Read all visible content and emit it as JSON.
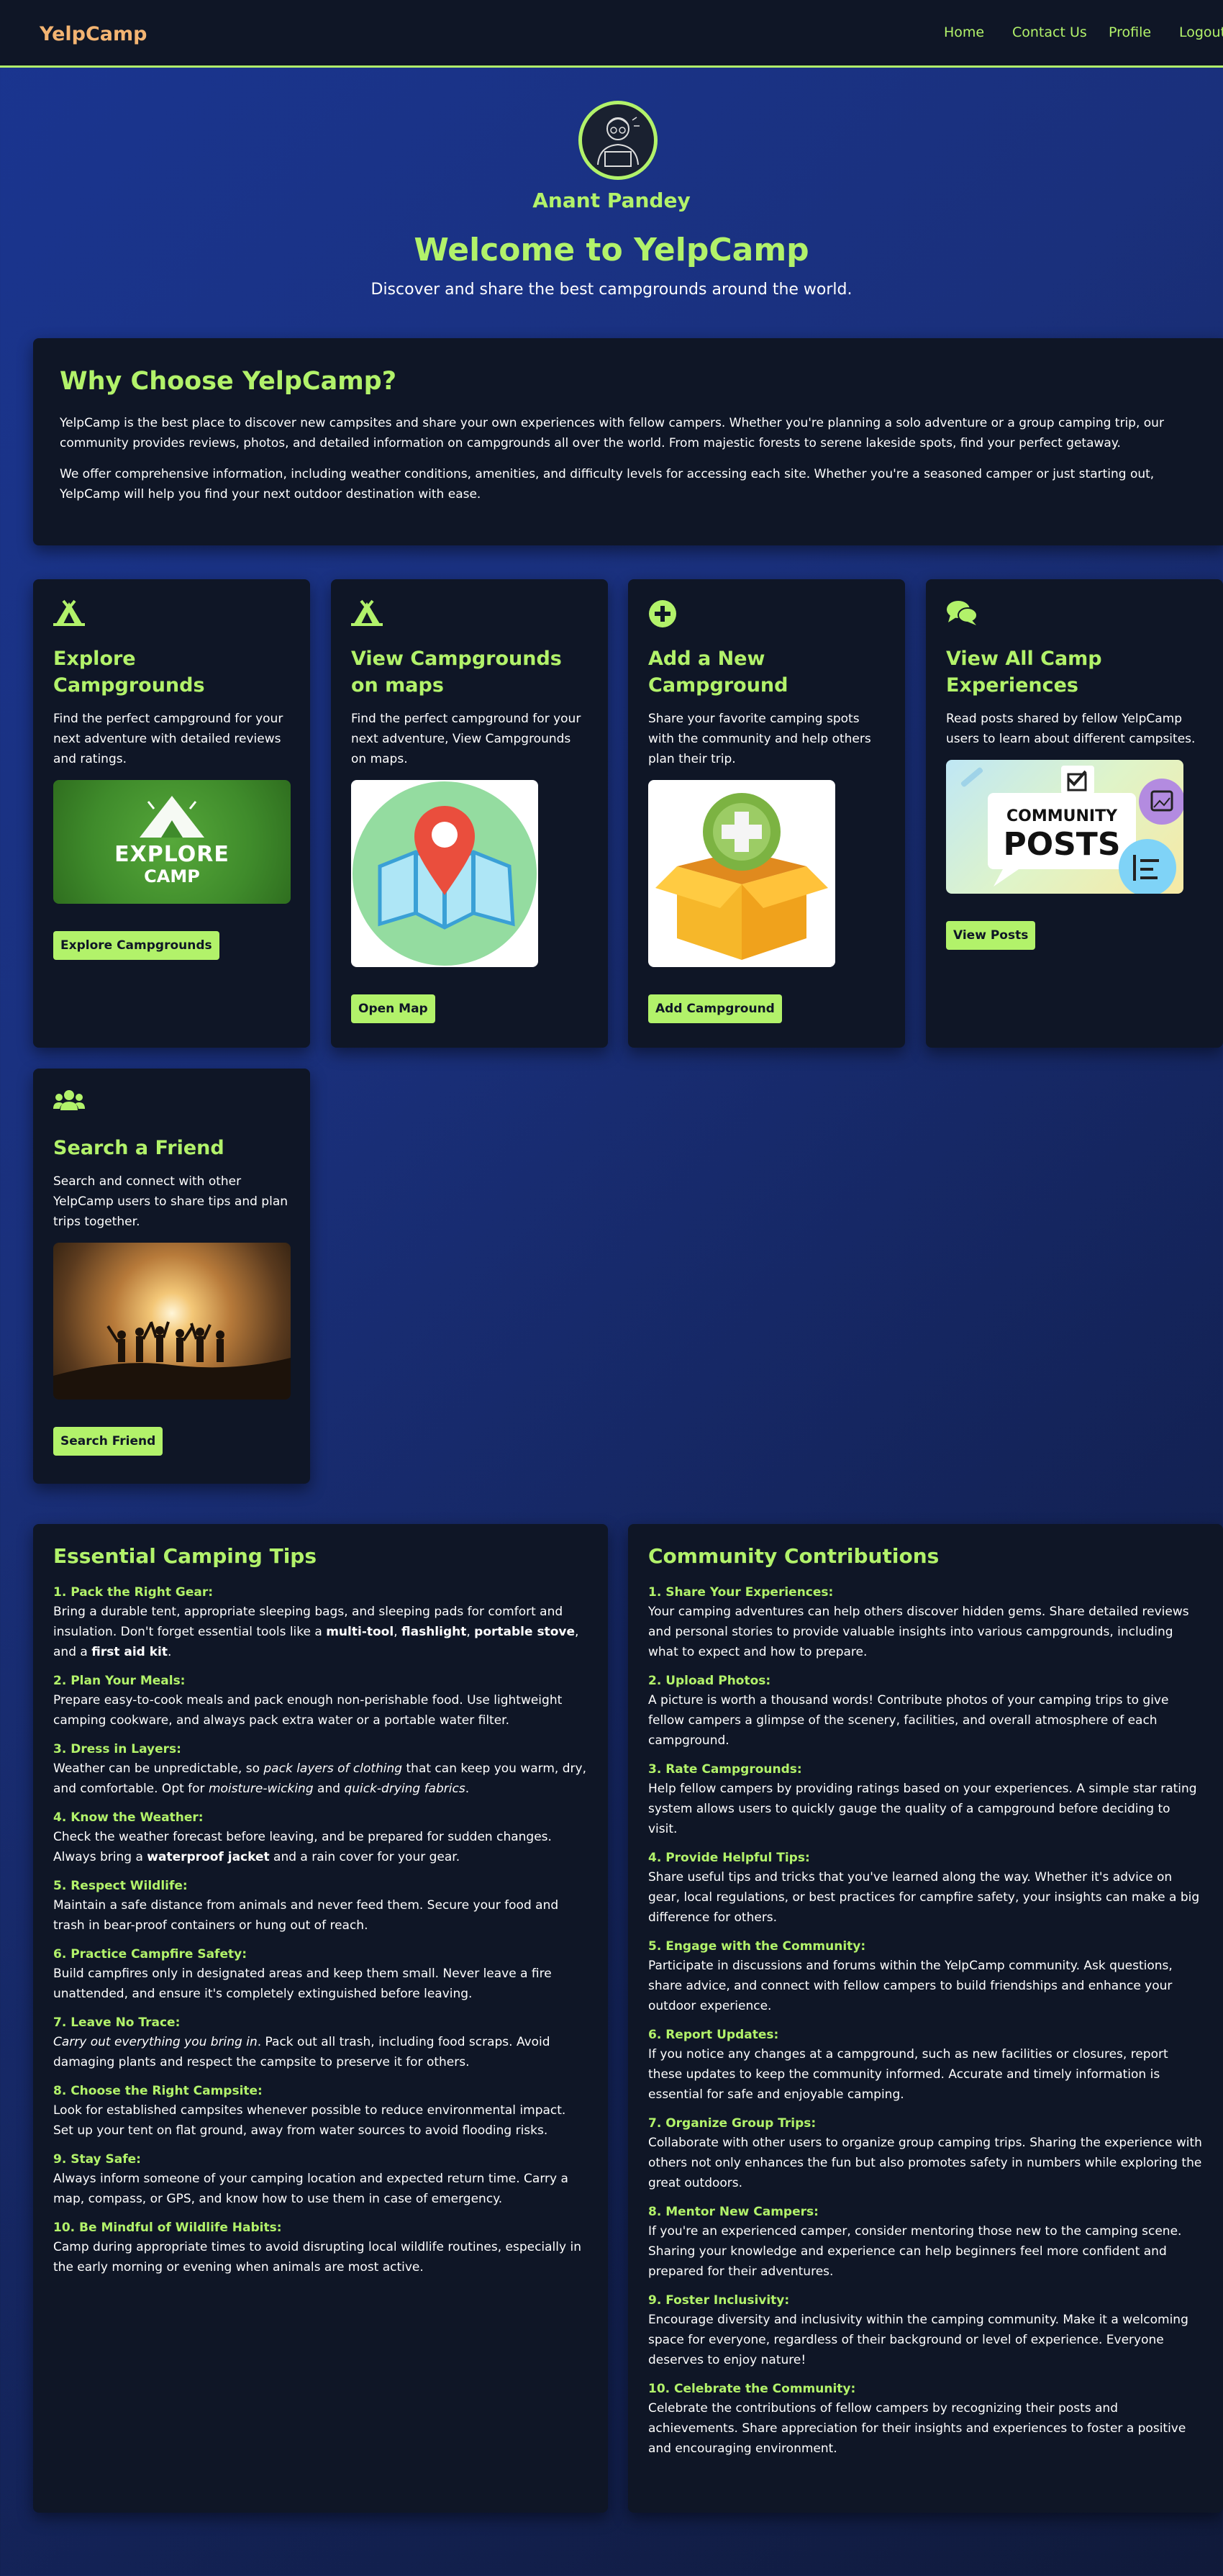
{
  "nav": {
    "brand": "YelpCamp",
    "links": [
      "Home",
      "Contact Us",
      "Profile",
      "Logout"
    ]
  },
  "hero": {
    "name": "Anant Pandey",
    "title": "Welcome to YelpCamp",
    "subtitle": "Discover and share the best campgrounds around the world."
  },
  "why": {
    "title": "Why Choose YelpCamp?",
    "paragraphs": [
      "YelpCamp is the best place to discover new campsites and share your own experiences with fellow campers. Whether you're planning a solo adventure or a group camping trip, our community provides reviews, photos, and detailed information on campgrounds all over the world. From majestic forests to serene lakeside spots, find your perfect getaway.",
      "We offer comprehensive information, including weather conditions, amenities, and difficulty levels for accessing each site. Whether you're a seasoned camper or just starting out, YelpCamp will help you find your next outdoor destination with ease."
    ]
  },
  "cards": [
    {
      "icon": "campground-icon",
      "title": "Explore Campgrounds",
      "text": "Find the perfect campground for your next adventure with detailed reviews and ratings.",
      "image_text": [
        "EXPLORE",
        "CAMP"
      ],
      "button": "Explore Campgrounds"
    },
    {
      "icon": "campground-icon",
      "title": "View Campgrounds on maps",
      "text": "Find the perfect campground for your next adventure, View Campgrounds on maps.",
      "button": "Open Map"
    },
    {
      "icon": "plus-circle-icon",
      "title": "Add a New Campground",
      "text": "Share your favorite camping spots with the community and help others plan their trip.",
      "button": "Add Campground"
    },
    {
      "icon": "comments-icon",
      "title": "View All Camp Experiences",
      "text": "Read posts shared by fellow YelpCamp users to learn about different campsites.",
      "image_text": [
        "COMMUNITY",
        "POSTS"
      ],
      "button": "View Posts"
    },
    {
      "icon": "users-icon",
      "title": "Search a Friend",
      "text": "Search and connect with other YelpCamp users to share tips and plan trips together.",
      "button": "Search Friend"
    }
  ],
  "tips": {
    "title": "Essential Camping Tips",
    "items": [
      {
        "title": "1. Pack the Right Gear:",
        "segments": [
          [
            "n",
            "Bring a durable tent, appropriate sleeping bags, and sleeping pads for comfort and insulation. Don't forget essential tools like a "
          ],
          [
            "b",
            "multi-tool"
          ],
          [
            "n",
            ", "
          ],
          [
            "b",
            "flashlight"
          ],
          [
            "n",
            ", "
          ],
          [
            "b",
            "portable stove"
          ],
          [
            "n",
            ", and a "
          ],
          [
            "b",
            "first aid kit"
          ],
          [
            "n",
            "."
          ]
        ]
      },
      {
        "title": "2. Plan Your Meals:",
        "segments": [
          [
            "n",
            "Prepare easy-to-cook meals and pack enough non-perishable food. Use lightweight camping cookware, and always pack extra water or a portable water filter."
          ]
        ]
      },
      {
        "title": "3. Dress in Layers:",
        "segments": [
          [
            "n",
            "Weather can be unpredictable, so "
          ],
          [
            "i",
            "pack layers of clothing"
          ],
          [
            "n",
            " that can keep you warm, dry, and comfortable. Opt for "
          ],
          [
            "i",
            "moisture-wicking"
          ],
          [
            "n",
            " and "
          ],
          [
            "i",
            "quick-drying fabrics"
          ],
          [
            "n",
            "."
          ]
        ]
      },
      {
        "title": "4. Know the Weather:",
        "segments": [
          [
            "n",
            "Check the weather forecast before leaving, and be prepared for sudden changes. Always bring a "
          ],
          [
            "b",
            "waterproof jacket"
          ],
          [
            "n",
            " and a rain cover for your gear."
          ]
        ]
      },
      {
        "title": "5. Respect Wildlife:",
        "segments": [
          [
            "n",
            "Maintain a safe distance from animals and never feed them. Secure your food and trash in bear-proof containers or hung out of reach."
          ]
        ]
      },
      {
        "title": "6. Practice Campfire Safety:",
        "segments": [
          [
            "n",
            "Build campfires only in designated areas and keep them small. Never leave a fire unattended, and ensure it's completely extinguished before leaving."
          ]
        ]
      },
      {
        "title": "7. Leave No Trace:",
        "segments": [
          [
            "i",
            "Carry out everything you bring in"
          ],
          [
            "n",
            ". Pack out all trash, including food scraps. Avoid damaging plants and respect the campsite to preserve it for others."
          ]
        ]
      },
      {
        "title": "8. Choose the Right Campsite:",
        "segments": [
          [
            "n",
            "Look for established campsites whenever possible to reduce environmental impact. Set up your tent on flat ground, away from water sources to avoid flooding risks."
          ]
        ]
      },
      {
        "title": "9. Stay Safe:",
        "segments": [
          [
            "n",
            "Always inform someone of your camping location and expected return time. Carry a map, compass, or GPS, and know how to use them in case of emergency."
          ]
        ]
      },
      {
        "title": "10. Be Mindful of Wildlife Habits:",
        "segments": [
          [
            "n",
            "Camp during appropriate times to avoid disrupting local wildlife routines, especially in the early morning or evening when animals are most active."
          ]
        ]
      }
    ]
  },
  "community": {
    "title": "Community Contributions",
    "items": [
      {
        "title": "1. Share Your Experiences:",
        "body": "Your camping adventures can help others discover hidden gems. Share detailed reviews and personal stories to provide valuable insights into various campgrounds, including what to expect and how to prepare."
      },
      {
        "title": "2. Upload Photos:",
        "body": "A picture is worth a thousand words! Contribute photos of your camping trips to give fellow campers a glimpse of the scenery, facilities, and overall atmosphere of each campground."
      },
      {
        "title": "3. Rate Campgrounds:",
        "body": "Help fellow campers by providing ratings based on your experiences. A simple star rating system allows users to quickly gauge the quality of a campground before deciding to visit."
      },
      {
        "title": "4. Provide Helpful Tips:",
        "body": "Share useful tips and tricks that you've learned along the way. Whether it's advice on gear, local regulations, or best practices for campfire safety, your insights can make a big difference for others."
      },
      {
        "title": "5. Engage with the Community:",
        "body": "Participate in discussions and forums within the YelpCamp community. Ask questions, share advice, and connect with fellow campers to build friendships and enhance your outdoor experience."
      },
      {
        "title": "6. Report Updates:",
        "body": "If you notice any changes at a campground, such as new facilities or closures, report these updates to keep the community informed. Accurate and timely information is essential for safe and enjoyable camping."
      },
      {
        "title": "7. Organize Group Trips:",
        "body": "Collaborate with other users to organize group camping trips. Sharing the experience with others not only enhances the fun but also promotes safety in numbers while exploring the great outdoors."
      },
      {
        "title": "8. Mentor New Campers:",
        "body": "If you're an experienced camper, consider mentoring those new to the camping scene. Sharing your knowledge and experience can help beginners feel more confident and prepared for their adventures."
      },
      {
        "title": "9. Foster Inclusivity:",
        "body": "Encourage diversity and inclusivity within the camping community. Make it a welcoming space for everyone, regardless of their background or level of experience. Everyone deserves to enjoy nature!"
      },
      {
        "title": "10. Celebrate the Community:",
        "body": "Celebrate the contributions of fellow campers by recognizing their posts and achievements. Share appreciation for their insights and experiences to foster a positive and encouraging environment."
      }
    ]
  },
  "colors": {
    "accent": "#b2f26a",
    "brand": "#f3b472",
    "panel": "#0f1626",
    "background": "#1a3590"
  }
}
